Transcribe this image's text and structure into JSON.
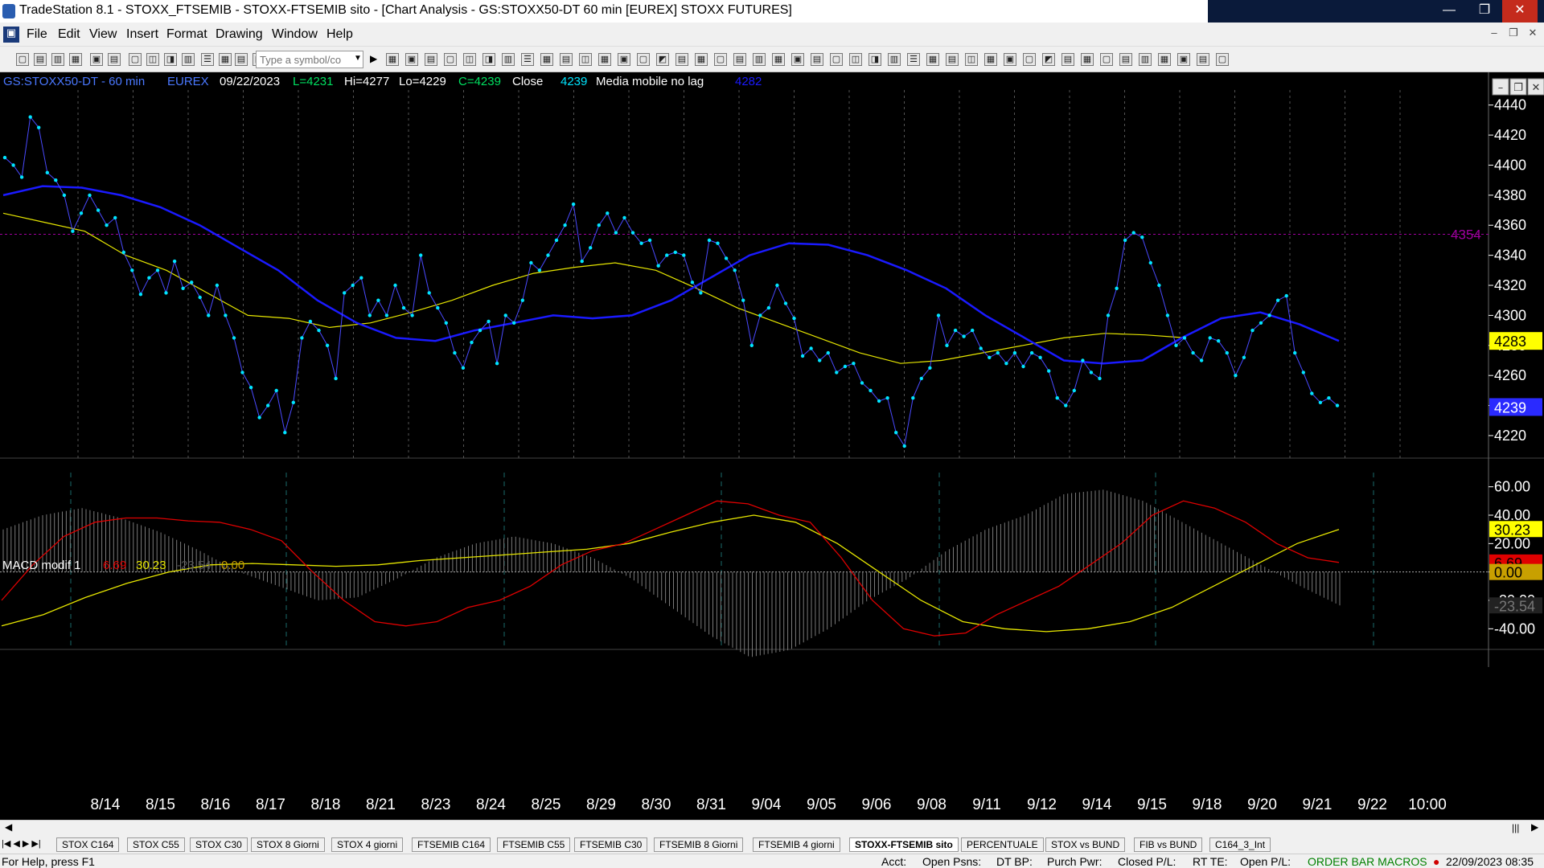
{
  "window": {
    "title": "TradeStation 8.1 - STOXX_FTSEMIB - STOXX-FTSEMIB sito - [Chart Analysis - GS:STOXX50-DT  60 min  [EUREX] STOXX FUTURES]",
    "minimize": "—",
    "maximize": "❐",
    "close": "✕"
  },
  "menu": [
    "File",
    "Edit",
    "View",
    "Insert",
    "Format",
    "Drawing",
    "Window",
    "Help"
  ],
  "toolbar": {
    "symbol_placeholder": "Type a symbol/co"
  },
  "chart_header": {
    "symbol": "GS:STOXX50-DT - 60 min",
    "exchange": "EUREX",
    "date": "09/22/2023",
    "low": "L=4231",
    "high": "Hi=4277",
    "lo": "Lo=4229",
    "close_val": "C=4239",
    "close_label": "Close",
    "close_num": "4239",
    "ma_label": "Media mobile no lag",
    "ma_val": "4282"
  },
  "macd_header": {
    "name": "MACD modif 1",
    "v1": "6.69",
    "v2": "30.23",
    "v3": "-23.54",
    "v4": "0.00"
  },
  "colors": {
    "price": "#00e5ff",
    "ma_blue": "#1a1aff",
    "ma_yellow": "#e6e600",
    "macd_red": "#e00000",
    "macd_yellow": "#e6e600",
    "hline": "#a000a0"
  },
  "chart_data": [
    {
      "type": "line",
      "title": "GS:STOXX50-DT - 60 min",
      "ylim": [
        4205,
        4450
      ],
      "y_ticks": [
        4440,
        4420,
        4400,
        4380,
        4360,
        4340,
        4320,
        4300,
        4280,
        4260,
        4240,
        4220
      ],
      "x_labels": [
        "8/14",
        "8/15",
        "8/16",
        "8/17",
        "8/18",
        "8/21",
        "8/23",
        "8/24",
        "8/25",
        "8/29",
        "8/30",
        "8/31",
        "9/04",
        "9/05",
        "9/06",
        "9/08",
        "9/11",
        "9/12",
        "9/14",
        "9/15",
        "9/18",
        "9/20",
        "9/21",
        "9/22",
        "10:00"
      ],
      "horizontal_line": {
        "value": 4354,
        "label": "4354"
      },
      "price_labels": [
        {
          "value": 4283,
          "label": "4283"
        },
        {
          "value": 4239,
          "label": "4239"
        }
      ],
      "series": [
        {
          "name": "Close",
          "values": [
            4405,
            4400,
            4392,
            4432,
            4425,
            4395,
            4390,
            4380,
            4356,
            4368,
            4380,
            4370,
            4360,
            4365,
            4342,
            4330,
            4314,
            4325,
            4330,
            4315,
            4336,
            4318,
            4322,
            4312,
            4300,
            4320,
            4300,
            4285,
            4262,
            4252,
            4232,
            4240,
            4250,
            4222,
            4242,
            4285,
            4296,
            4290,
            4280,
            4258,
            4315,
            4320,
            4325,
            4300,
            4310,
            4300,
            4320,
            4305,
            4300,
            4340,
            4315,
            4305,
            4295,
            4275,
            4265,
            4282,
            4290,
            4296,
            4268,
            4300,
            4295,
            4310,
            4335,
            4330,
            4340,
            4350,
            4360,
            4374,
            4336,
            4345,
            4360,
            4368,
            4355,
            4365,
            4355,
            4348,
            4350,
            4333,
            4340,
            4342,
            4340,
            4322,
            4315,
            4350,
            4348,
            4338,
            4330,
            4310,
            4280,
            4300,
            4305,
            4320,
            4308,
            4298,
            4273,
            4278,
            4270,
            4275,
            4262,
            4266,
            4268,
            4255,
            4250,
            4243,
            4245,
            4222,
            4213,
            4245,
            4258,
            4265,
            4300,
            4280,
            4290,
            4286,
            4290,
            4278,
            4272,
            4275,
            4268,
            4275,
            4266,
            4275,
            4272,
            4263,
            4245,
            4240,
            4250,
            4270,
            4262,
            4258,
            4300,
            4318,
            4350,
            4355,
            4352,
            4335,
            4320,
            4300,
            4280,
            4285,
            4275,
            4270,
            4285,
            4283,
            4275,
            4260,
            4272,
            4290,
            4295,
            4300,
            4310,
            4313,
            4275,
            4262,
            4248,
            4242,
            4245,
            4240
          ],
          "note": "hourly closes (approximate) ending at 4239"
        },
        {
          "name": "Media mobile no lag",
          "values": [
            4380,
            4386,
            4385,
            4380,
            4372,
            4360,
            4345,
            4330,
            4310,
            4295,
            4285,
            4283,
            4290,
            4295,
            4300,
            4298,
            4300,
            4310,
            4325,
            4340,
            4348,
            4347,
            4340,
            4330,
            4318,
            4300,
            4285,
            4270,
            4268,
            4270,
            4285,
            4298,
            4302,
            4294,
            4283
          ]
        },
        {
          "name": "MA yellow",
          "values": [
            4368,
            4362,
            4356,
            4340,
            4330,
            4315,
            4300,
            4298,
            4292,
            4295,
            4302,
            4310,
            4320,
            4328,
            4332,
            4335,
            4330,
            4318,
            4305,
            4295,
            4285,
            4275,
            4268,
            4270,
            4275,
            4280,
            4285,
            4288,
            4287,
            4285
          ]
        }
      ]
    },
    {
      "type": "line",
      "title": "MACD modif 1",
      "ylim": [
        -50,
        70
      ],
      "y_ticks": [
        60,
        40,
        20,
        0,
        -20,
        -40
      ],
      "value_labels": [
        {
          "value": 30.23,
          "label": "30.23"
        },
        {
          "value": 6.69,
          "label": "6.69"
        },
        {
          "value": 0,
          "label": "0.00"
        },
        {
          "value": -23.54,
          "label": "-23.54"
        }
      ],
      "series": [
        {
          "name": "MACD",
          "values": [
            -20,
            5,
            25,
            35,
            38,
            38,
            36,
            35,
            30,
            22,
            0,
            -20,
            -35,
            -38,
            -35,
            -25,
            -20,
            -10,
            5,
            15,
            20,
            30,
            40,
            50,
            48,
            40,
            35,
            10,
            -20,
            -40,
            -45,
            -43,
            -30,
            -20,
            -10,
            5,
            20,
            40,
            50,
            45,
            35,
            20,
            10,
            6.69
          ]
        },
        {
          "name": "Signal",
          "values": [
            -38,
            -30,
            -18,
            -8,
            0,
            5,
            6,
            5,
            4,
            5,
            8,
            10,
            12,
            14,
            16,
            20,
            28,
            35,
            40,
            35,
            20,
            0,
            -20,
            -35,
            -40,
            -42,
            -40,
            -35,
            -25,
            -10,
            5,
            20,
            30
          ]
        },
        {
          "name": "Histogram",
          "values": [
            30,
            40,
            45,
            38,
            28,
            15,
            0,
            -10,
            -20,
            -18,
            -5,
            10,
            20,
            25,
            20,
            10,
            -5,
            -25,
            -45,
            -60,
            -55,
            -40,
            -20,
            -5,
            15,
            30,
            40,
            55,
            58,
            50,
            35,
            20,
            5,
            -10,
            -23.54
          ]
        }
      ]
    }
  ],
  "tabs": [
    "STOX C164",
    "STOX C55",
    "STOX  C30",
    "STOX  8 Giorni",
    "STOX 4 giorni",
    "FTSEMIB C164",
    "FTSEMIB C55",
    "FTSEMIB C30",
    "FTSEMIB  8 Giorni",
    "FTSEMIB  4 giorni",
    "STOXX-FTSEMIB sito",
    "PERCENTUALE",
    "STOX vs BUND",
    "FIB vs BUND",
    "C164_3_Int"
  ],
  "active_tab": "STOXX-FTSEMIB sito",
  "status": {
    "help": "For Help, press F1",
    "acct": "Acct:",
    "open_psns": "Open Psns:",
    "dt_bp": "DT BP:",
    "purch_pwr": "Purch Pwr:",
    "closed_pl": "Closed P/L:",
    "rt_te": "RT TE:",
    "open_pl": "Open P/L:",
    "macros": "ORDER BAR  MACROS",
    "datetime": "22/09/2023 08:35"
  }
}
